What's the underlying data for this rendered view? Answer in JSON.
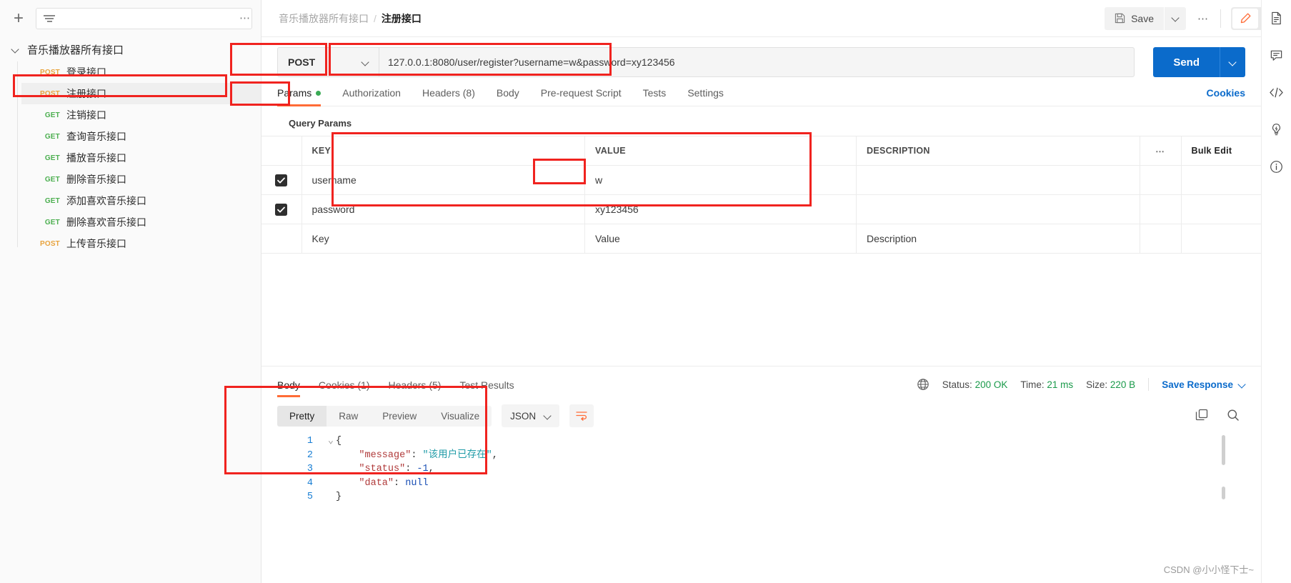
{
  "sidebar": {
    "add_label": "+",
    "filter_placeholder": "",
    "more_label": "⋯",
    "collection": {
      "name": "音乐播放器所有接口",
      "requests": [
        {
          "method": "POST",
          "name": "登录接口",
          "active": false
        },
        {
          "method": "POST",
          "name": "注册接口",
          "active": true
        },
        {
          "method": "GET",
          "name": "注销接口",
          "active": false
        },
        {
          "method": "GET",
          "name": "查询音乐接口",
          "active": false
        },
        {
          "method": "GET",
          "name": "播放音乐接口",
          "active": false
        },
        {
          "method": "GET",
          "name": "删除音乐接口",
          "active": false
        },
        {
          "method": "GET",
          "name": "添加喜欢音乐接口",
          "active": false
        },
        {
          "method": "GET",
          "name": "删除喜欢音乐接口",
          "active": false
        },
        {
          "method": "POST",
          "name": "上传音乐接口",
          "active": false
        }
      ]
    }
  },
  "header": {
    "breadcrumb_collection": "音乐播放器所有接口",
    "breadcrumb_separator": "/",
    "breadcrumb_current": "注册接口",
    "save_label": "Save",
    "more_label": "⋯"
  },
  "request": {
    "method": "POST",
    "url": "127.0.0.1:8080/user/register?username=w&password=xy123456",
    "send_label": "Send",
    "tabs": [
      {
        "label": "Params",
        "active": true,
        "dot": true
      },
      {
        "label": "Authorization",
        "active": false,
        "dot": false
      },
      {
        "label": "Headers (8)",
        "active": false,
        "dot": false
      },
      {
        "label": "Body",
        "active": false,
        "dot": false
      },
      {
        "label": "Pre-request Script",
        "active": false,
        "dot": false
      },
      {
        "label": "Tests",
        "active": false,
        "dot": false
      },
      {
        "label": "Settings",
        "active": false,
        "dot": false
      }
    ],
    "cookies_label": "Cookies",
    "query_params_label": "Query Params",
    "table": {
      "columns": [
        "KEY",
        "VALUE",
        "DESCRIPTION"
      ],
      "dots_label": "⋯",
      "bulk_edit_label": "Bulk Edit",
      "rows": [
        {
          "checked": true,
          "key": "username",
          "value": "w",
          "description": ""
        },
        {
          "checked": true,
          "key": "password",
          "value": "xy123456",
          "description": ""
        }
      ],
      "empty_row": {
        "key": "Key",
        "value": "Value",
        "description": "Description"
      }
    }
  },
  "response": {
    "tabs": [
      {
        "label": "Body",
        "active": true
      },
      {
        "label": "Cookies (1)",
        "active": false
      },
      {
        "label": "Headers (5)",
        "active": false
      },
      {
        "label": "Test Results",
        "active": false
      }
    ],
    "status_label": "Status:",
    "status_value": "200 OK",
    "time_label": "Time:",
    "time_value": "21 ms",
    "size_label": "Size:",
    "size_value": "220 B",
    "save_response_label": "Save Response",
    "view_modes": [
      {
        "label": "Pretty",
        "active": true
      },
      {
        "label": "Raw",
        "active": false
      },
      {
        "label": "Preview",
        "active": false
      },
      {
        "label": "Visualize",
        "active": false
      }
    ],
    "format": "JSON",
    "body_lines": [
      {
        "num": "1",
        "fold": "⌄",
        "tokens": [
          {
            "t": "{",
            "c": "p"
          }
        ]
      },
      {
        "num": "2",
        "fold": "",
        "tokens": [
          {
            "t": "    ",
            "c": "p"
          },
          {
            "t": "\"message\"",
            "c": "k"
          },
          {
            "t": ": ",
            "c": "p"
          },
          {
            "t": "\"该用户已存在\"",
            "c": "s"
          },
          {
            "t": ",",
            "c": "p"
          }
        ]
      },
      {
        "num": "3",
        "fold": "",
        "tokens": [
          {
            "t": "    ",
            "c": "p"
          },
          {
            "t": "\"status\"",
            "c": "k"
          },
          {
            "t": ": ",
            "c": "p"
          },
          {
            "t": "-1",
            "c": "n"
          },
          {
            "t": ",",
            "c": "p"
          }
        ]
      },
      {
        "num": "4",
        "fold": "",
        "tokens": [
          {
            "t": "    ",
            "c": "p"
          },
          {
            "t": "\"data\"",
            "c": "k"
          },
          {
            "t": ": ",
            "c": "p"
          },
          {
            "t": "null",
            "c": "n"
          }
        ]
      },
      {
        "num": "5",
        "fold": "⌃",
        "tokens": [
          {
            "t": "}",
            "c": "p"
          }
        ]
      }
    ]
  },
  "watermark": "CSDN @小小怪下士~",
  "colors": {
    "accent_orange": "#ff6c37",
    "send_blue": "#0b6bcb",
    "highlight_red": "#f0231f",
    "status_green": "#1a9a4a",
    "post_orange": "#e8a33d",
    "get_green": "#4caf50"
  }
}
